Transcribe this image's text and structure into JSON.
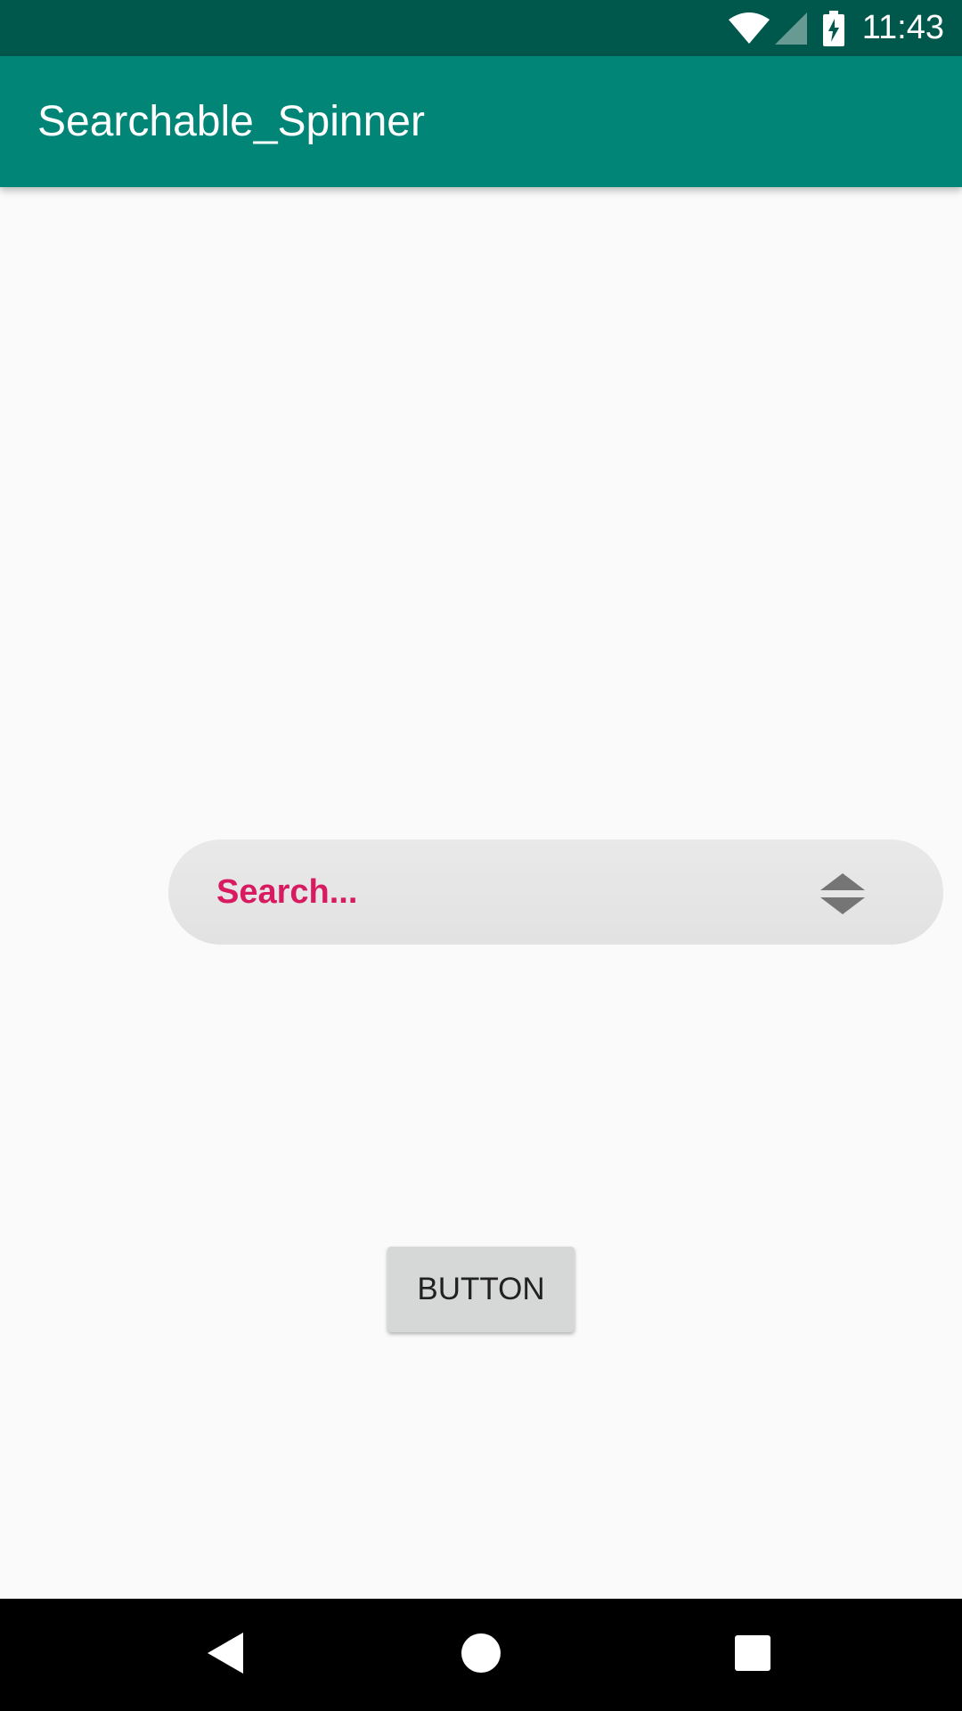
{
  "status_bar": {
    "time": "11:43",
    "icons": [
      "wifi-icon",
      "cell-signal-icon",
      "battery-charging-icon"
    ]
  },
  "app_bar": {
    "title": "Searchable_Spinner"
  },
  "spinner": {
    "placeholder": "Search...",
    "icon": "up-down-arrows-icon"
  },
  "button": {
    "label": "BUTTON"
  },
  "nav_bar": {
    "icons": [
      "back-icon",
      "home-icon",
      "recents-icon"
    ]
  },
  "colors": {
    "status_bar": "#00574b",
    "app_bar": "#008577",
    "accent": "#d81b60",
    "background": "#fafafa"
  }
}
